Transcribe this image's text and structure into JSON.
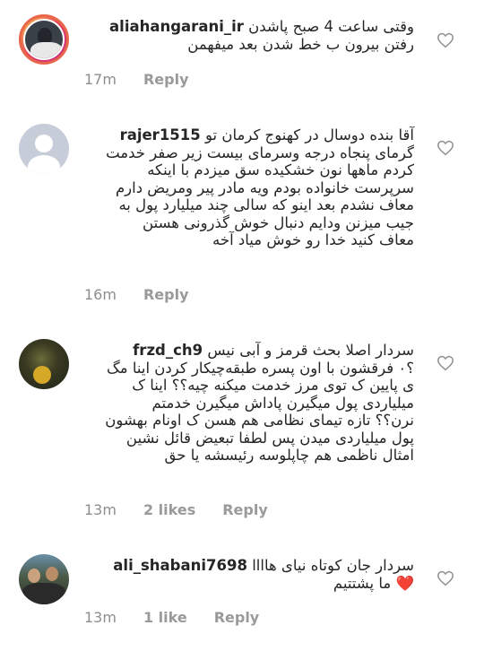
{
  "comments": [
    {
      "username": "aliahangarani_ir",
      "lines": [
        "وقتی ساعت 4 صبح پاشدن",
        "رفتن بیرون ب خط شدن بعد میفهمن"
      ],
      "time": "17m",
      "likes": "",
      "reply": "Reply"
    },
    {
      "username": "rajer1515",
      "lines": [
        "آقا بنده دوسال در کهنوج کرمان تو",
        "گرمای پنجاه درجه وسرمای بیست زیر صفر خدمت",
        "کردم ماهها نون خشکیده سق میزدم با اینکه",
        "سرپرست خانواده بودم ویه مادر پیر ومریض دارم",
        "معاف نشدم بعد اینو که سالی چند میلیارد پول به",
        "جیب میزنن ودایم دنبال خوش گذرونی هستن",
        "معاف کنید خدا رو خوش میاد آخه"
      ],
      "time": "16m",
      "likes": "",
      "reply": "Reply"
    },
    {
      "username": "frzd_ch9",
      "lines": [
        "سردار اصلا بحث قرمز و آبی نیس",
        "؟۰ فرقشون با اون پسره طبقه‌چیکار کردن اینا مگ",
        "ی پایین ک توی مرز خدمت میکنه چیه؟؟ اینا ک",
        "میلیاردی پول میگیرن پاداش میگیرن خدمتم",
        "نرن؟؟ تازه تیمای نظامی هم هسن ک اونام بهشون",
        "پول میلیاردی میدن  پس لطفا تبعیض قائل نشین",
        "امثال ناظمی هم چاپلوسه رئیسشه یا حق"
      ],
      "time": "13m",
      "likes": "2 likes",
      "reply": "Reply"
    },
    {
      "username": "ali_shabani7698",
      "lines": [
        "سردار جان کوتاه نیای هاااا",
        "❤️ ما پشتتیم"
      ],
      "time": "13m",
      "likes": "1 like",
      "reply": "Reply"
    }
  ],
  "colors": {
    "heart": "#e8304a",
    "meta": "#8e8e8e",
    "ring": "#e5405e"
  },
  "icons": {
    "like": "heart-outline-icon"
  }
}
